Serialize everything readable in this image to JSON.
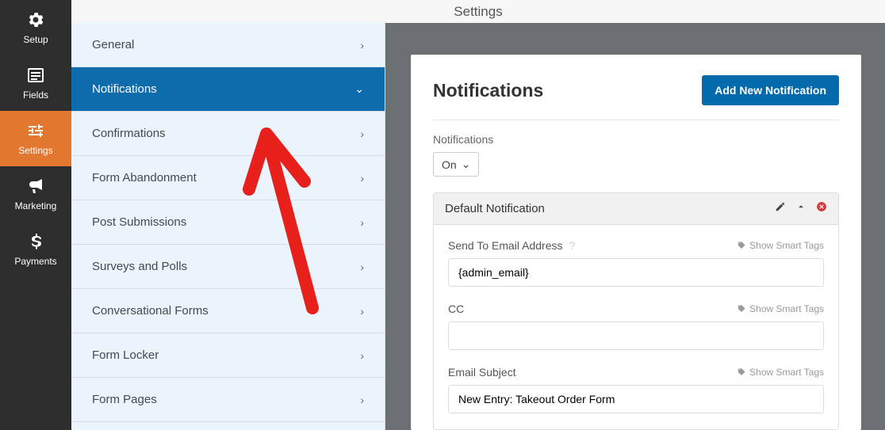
{
  "iconbar": {
    "items": [
      {
        "label": "Setup",
        "name": "gear-icon"
      },
      {
        "label": "Fields",
        "name": "list-icon"
      },
      {
        "label": "Settings",
        "name": "sliders-icon"
      },
      {
        "label": "Marketing",
        "name": "bullhorn-icon"
      },
      {
        "label": "Payments",
        "name": "dollar-icon"
      }
    ]
  },
  "header": {
    "title": "Settings"
  },
  "submenu": {
    "items": [
      "General",
      "Notifications",
      "Confirmations",
      "Form Abandonment",
      "Post Submissions",
      "Surveys and Polls",
      "Conversational Forms",
      "Form Locker",
      "Form Pages"
    ]
  },
  "panel": {
    "title": "Notifications",
    "add_button": "Add New Notification",
    "toggle_label": "Notifications",
    "toggle_value": "On",
    "block_title": "Default Notification",
    "smart_tags_label": "Show Smart Tags",
    "fields": {
      "send_to": {
        "label": "Send To Email Address",
        "value": "{admin_email}"
      },
      "cc": {
        "label": "CC",
        "value": ""
      },
      "subject": {
        "label": "Email Subject",
        "value": "New Entry: Takeout Order Form"
      }
    }
  }
}
